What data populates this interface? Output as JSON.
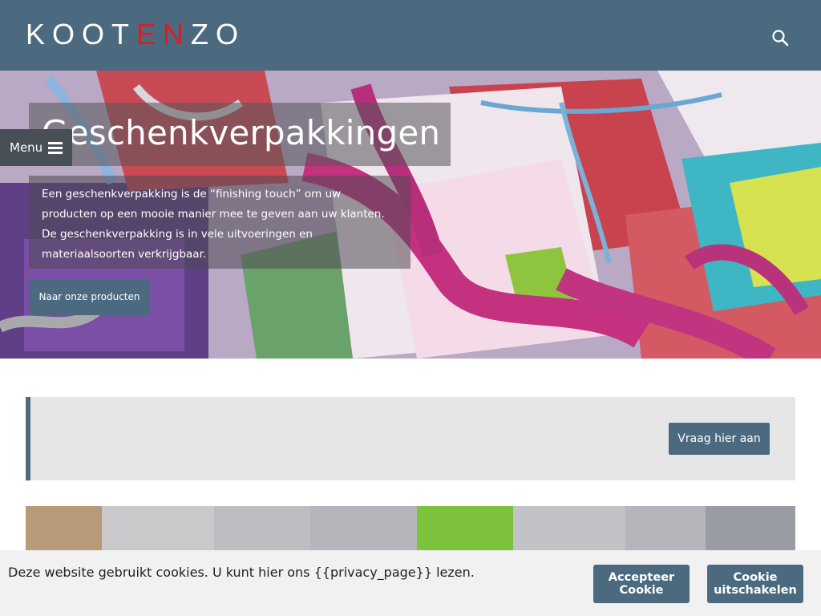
{
  "header": {
    "logo_part1": "KOOT",
    "logo_part2": "EN",
    "logo_part3": "ZO",
    "search_icon": "search-icon"
  },
  "menu": {
    "label": "Menu",
    "icon": "hamburger-icon"
  },
  "hero": {
    "title": "Geschenkverpakkingen",
    "description": "Een geschenkverpakking is de “finishing touch” om uw producten op een mooie manier mee te geven aan uw klanten. De geschenkverpakking is in vele uitvoeringen en materiaalsoorten verkrijgbaar.",
    "button_label": "Naar onze producten"
  },
  "info": {
    "button_label": "Vraag hier aan"
  },
  "cookie": {
    "text": "Deze website gebruikt cookies. U kunt hier ons {{privacy_page}} lezen.",
    "accept_label_line1": "Accepteer",
    "accept_label_line2": "Cookie",
    "disable_label_line1": "Cookie",
    "disable_label_line2": "uitschakelen"
  },
  "colors": {
    "brand": "#4b6a80",
    "accent": "#e3191f",
    "menu_tab": "#484f56",
    "info_bg": "#e6e6e6",
    "cookie_bg": "#f1f1f1"
  }
}
